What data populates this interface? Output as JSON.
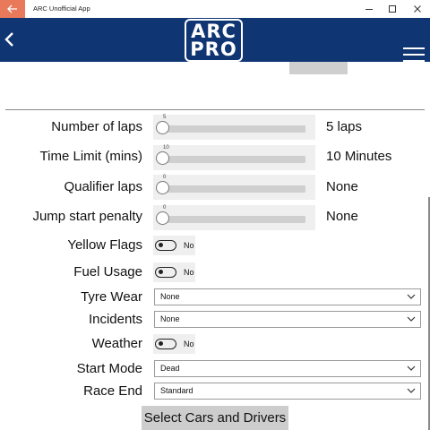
{
  "window": {
    "title": "ARC Unofficial App"
  },
  "app": {
    "logo_line1": "ARC",
    "logo_line2": "PRO"
  },
  "sliders": [
    {
      "label": "Number of laps",
      "tick": "5",
      "value": "5 laps"
    },
    {
      "label": "Time Limit (mins)",
      "tick": "10",
      "value": "10 Minutes"
    },
    {
      "label": "Qualifier laps",
      "tick": "0",
      "value": "None"
    },
    {
      "label": "Jump start penalty",
      "tick": "0",
      "value": "None"
    }
  ],
  "toggles": [
    {
      "label": "Yellow Flags",
      "state": "No"
    },
    {
      "label": "Fuel Usage",
      "state": "No"
    },
    {
      "label": "Weather",
      "state": "No"
    }
  ],
  "selects": [
    {
      "label": "Tyre Wear",
      "value": "None"
    },
    {
      "label": "Incidents",
      "value": "None"
    },
    {
      "label": "Start Mode",
      "value": "Dead"
    },
    {
      "label": "Race End",
      "value": "Standard"
    }
  ],
  "actions": {
    "select_cars_label": "Select Cars and Drivers"
  },
  "colors": {
    "header_bg": "#0f3673",
    "back_button_bg": "#e8795a"
  },
  "icons": {
    "back": "back-arrow-icon",
    "menu": "hamburger-menu-icon",
    "chevron": "chevron-down-icon"
  }
}
